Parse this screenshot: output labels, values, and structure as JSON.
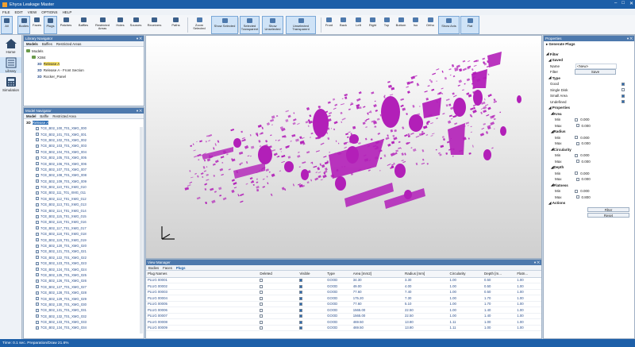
{
  "app": {
    "title": "Ehyca Leakage Master",
    "window_controls": [
      "–",
      "□",
      "✕"
    ]
  },
  "menu": [
    "FILE",
    "EDIT",
    "VIEW",
    "OPTIONS",
    "HELP"
  ],
  "ribbon": {
    "buttons": [
      {
        "label": "All",
        "icon": "all-icon"
      },
      {
        "label": "Bodies",
        "icon": "bodies-icon"
      },
      {
        "label": "Faces",
        "icon": "faces-icon"
      },
      {
        "label": "Plugs",
        "icon": "plugs-icon"
      },
      {
        "label": "Patches",
        "icon": "patches-icon"
      },
      {
        "label": "Baffles",
        "icon": "baffles-icon"
      },
      {
        "label": "Restricted Areas",
        "icon": "restricted-areas-icon"
      },
      {
        "label": "Holes",
        "icon": "holes-icon"
      },
      {
        "label": "Sources",
        "icon": "sources-icon"
      },
      {
        "label": "Receivers",
        "icon": "receivers-icon"
      },
      {
        "label": "Paths",
        "icon": "paths-icon"
      },
      {
        "label": "Zoom Selected",
        "icon": "zoom-selected-icon"
      },
      {
        "label": "Show Selected",
        "icon": "show-selected-icon"
      },
      {
        "label": "Selected Transparent",
        "icon": "selected-transparent-icon"
      },
      {
        "label": "Show Unselected",
        "icon": "show-unselected-icon"
      },
      {
        "label": "Unselected Transparent",
        "icon": "unselected-transparent-icon"
      },
      {
        "label": "Front",
        "icon": "front-view-icon"
      },
      {
        "label": "Back",
        "icon": "back-view-icon"
      },
      {
        "label": "Left",
        "icon": "left-view-icon"
      },
      {
        "label": "Right",
        "icon": "right-view-icon"
      },
      {
        "label": "Top",
        "icon": "top-view-icon"
      },
      {
        "label": "Bottom",
        "icon": "bottom-view-icon"
      },
      {
        "label": "Iso",
        "icon": "iso-view-icon"
      },
      {
        "label": "Ortho",
        "icon": "ortho-view-icon"
      },
      {
        "label": "Show Axis",
        "icon": "show-axis-icon"
      },
      {
        "label": "Flat",
        "icon": "flat-shading-icon"
      }
    ],
    "all_prefix": "ALL"
  },
  "sidebar": [
    {
      "label": "Home",
      "icon": "home-icon"
    },
    {
      "label": "Library",
      "icon": "library-icon"
    },
    {
      "label": "Simulation",
      "icon": "simulation-icon"
    }
  ],
  "library_navigator": {
    "title": "Library Navigator",
    "tabs": [
      "Models",
      "Baffles",
      "Restricted Areas"
    ],
    "tree": [
      {
        "label": "Models",
        "depth": 0
      },
      {
        "label": "X384",
        "depth": 1
      },
      {
        "label": "Release A",
        "depth": 2,
        "selected": true
      },
      {
        "label": "Release A - Front Section",
        "depth": 2
      },
      {
        "label": "Rocker_Panel",
        "depth": 2
      }
    ],
    "prefix": "3D"
  },
  "model_navigator": {
    "title": "Model Navigator",
    "tabs": [
      "Model",
      "Baffle",
      "Restricted Area"
    ],
    "root": "Release A",
    "items": [
      "7CE_B02_100_T01_XMG_000",
      "7CE_B02_101_T01_XMG_001",
      "7CE_B02_102_T01_XMG_002",
      "7CE_B02_103_T01_XMG_003",
      "7CE_B02_104_T01_XMG_004",
      "7CE_B02_105_T01_XMG_005",
      "7CE_B02_106_T01_XMG_006",
      "7CE_B02_107_T01_XMG_007",
      "7CE_B02_108_T01_XMG_008",
      "7CE_B02_109_T01_XMG_009",
      "7CE_B02_110_T01_XMG_010",
      "7CE_B02_111_T01_XMG_011",
      "7CE_B02_112_T01_XMG_012",
      "7CE_B02_113_T01_XMG_013",
      "7CE_B02_114_T01_XMG_014",
      "7CE_B02_115_T01_XMG_015",
      "7CE_B02_116_T01_XMG_016",
      "7CE_B02_117_T01_XMG_017",
      "7CE_B02_118_T01_XMG_018",
      "7CE_B02_119_T01_XMG_019",
      "7CE_B02_120_T01_XMG_020",
      "7CE_B02_121_T01_XMG_021",
      "7CE_B02_122_T01_XMG_022",
      "7CE_B02_123_T01_XMG_023",
      "7CE_B02_124_T01_XMG_024",
      "7CE_B02_125_T01_XMG_025",
      "7CE_B02_126_T01_XMG_026",
      "7CE_B02_127_T01_XMG_027",
      "7CE_B02_128_T01_XMG_028",
      "7CE_B02_129_T01_XMG_029",
      "7CE_B02_130_T01_XMG_030",
      "7CE_B02_131_T01_XMG_031",
      "7CE_B02_132_T01_XMG_032",
      "7CE_B02_133_T01_XMG_033",
      "7CE_B02_134_T01_XMG_034"
    ]
  },
  "view_manager": {
    "title": "View Manager",
    "tabs": [
      "Bodies",
      "Faces",
      "Plugs"
    ],
    "columns": [
      "Plug Names",
      "Deleted",
      "Visible",
      "Type",
      "Area [mm2]",
      "Radius [mm]",
      "Circularity",
      "Depth [m...",
      "Flatn..."
    ],
    "rows": [
      [
        "PLUG 00001",
        false,
        true,
        "GOOD",
        "34.30",
        "3.30",
        "1.00",
        "0.50",
        "1.00"
      ],
      [
        "PLUG 00002",
        false,
        true,
        "GOOD",
        "49.00",
        "4.00",
        "1.00",
        "0.50",
        "1.00"
      ],
      [
        "PLUG 00003",
        false,
        true,
        "GOOD",
        "77.60",
        "7.40",
        "1.00",
        "0.50",
        "1.00"
      ],
      [
        "PLUG 00004",
        false,
        true,
        "GOOD",
        "175.20",
        "7.30",
        "1.00",
        "1.70",
        "1.00"
      ],
      [
        "PLUG 00005",
        false,
        true,
        "GOOD",
        "77.60",
        "5.10",
        "1.00",
        "1.70",
        "1.00"
      ],
      [
        "PLUG 00006",
        false,
        true,
        "GOOD",
        "1565.00",
        "22.50",
        "1.00",
        "1.40",
        "1.00"
      ],
      [
        "PLUG 00007",
        false,
        true,
        "GOOD",
        "1565.00",
        "22.50",
        "1.00",
        "1.40",
        "1.00"
      ],
      [
        "PLUG 00008",
        false,
        true,
        "GOOD",
        "469.50",
        "13.80",
        "1.11",
        "1.00",
        "1.00"
      ],
      [
        "PLUG 00009",
        false,
        true,
        "GOOD",
        "469.50",
        "13.80",
        "1.11",
        "1.00",
        "1.00"
      ]
    ]
  },
  "properties": {
    "title": "Properties",
    "section": "Generate Plugs",
    "filter_label": "Filter",
    "saved_label": "Saved",
    "name_label": "Name",
    "name_value": "<New>",
    "filter_row_label": "Filter",
    "save_button": "Save",
    "type_label": "Type",
    "types": [
      {
        "label": "Good",
        "checked": true
      },
      {
        "label": "Single Disk",
        "checked": false
      },
      {
        "label": "Small Area",
        "checked": true
      },
      {
        "label": "Undefined",
        "checked": true
      }
    ],
    "properties_label": "Properties",
    "groups": [
      {
        "label": "Area",
        "min": "0.000",
        "max": "0.000"
      },
      {
        "label": "Radius",
        "min": "0.000",
        "max": "0.000"
      },
      {
        "label": "Circularity",
        "min": "0.000",
        "max": "0.000"
      },
      {
        "label": "Depth",
        "min": "0.000",
        "max": "0.000"
      },
      {
        "label": "Flatness",
        "min": "0.000",
        "max": "0.800"
      }
    ],
    "min_label": "Min",
    "max_label": "Max",
    "actions_label": "Actions",
    "filter_button": "Filter",
    "reset_button": "Reset"
  },
  "status": "Time: 0.1 sec. Preparation/Draw 21.6%",
  "colors": {
    "accent": "#1d5fa8",
    "part": "#b21fb8",
    "header": "#4d79ad"
  }
}
